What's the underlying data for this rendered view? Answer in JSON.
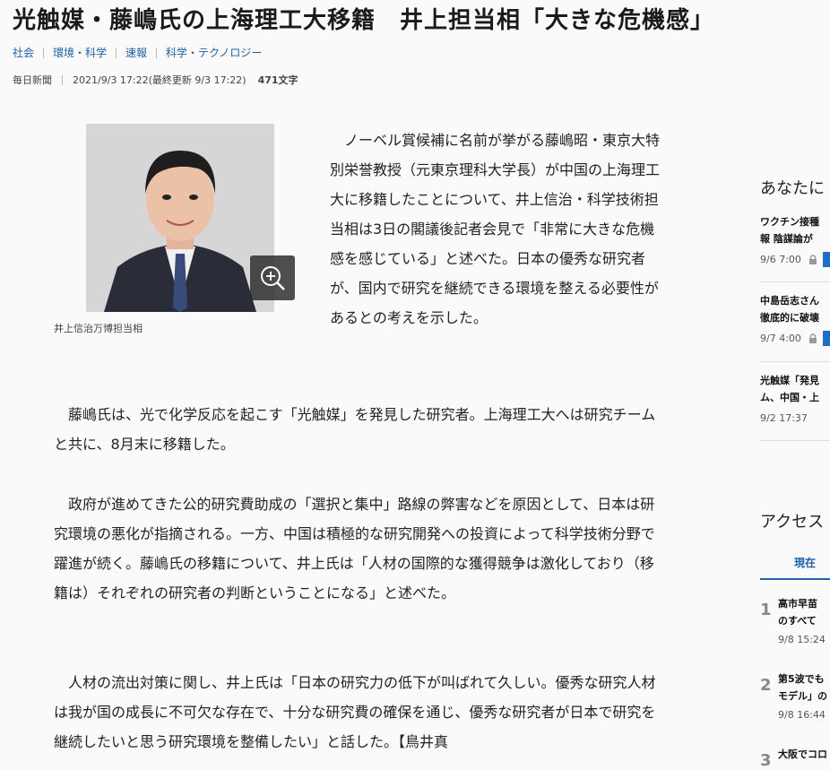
{
  "article": {
    "title": "光触媒・藤嶋氏の上海理工大移籍　井上担当相「大きな危機感」",
    "tags": [
      "社会",
      "環境・科学",
      "速報",
      "科学・テクノロジー"
    ],
    "source": "毎日新聞",
    "date": "2021/9/3 17:22(最終更新 9/3 17:22)",
    "char_count": "471文字",
    "photo_caption": "井上信治万博担当相",
    "paragraphs": [
      "　ノーベル賞候補に名前が挙がる藤嶋昭・東京大特別栄誉教授（元東京理科大学長）が中国の上海理工大に移籍したことについて、井上信治・科学技術担当相は3日の閣議後記者会見で「非常に大きな危機感を感じている」と述べた。日本の優秀な研究者が、国内で研究を継続できる環境を整える必要性があるとの考えを示した。",
      "　藤嶋氏は、光で化学反応を起こす「光触媒」を発見した研究者。上海理工大へは研究チームと共に、8月末に移籍した。",
      "　政府が進めてきた公的研究費助成の「選択と集中」路線の弊害などを原因として、日本は研究環境の悪化が指摘される。一方、中国は積極的な研究開発への投資によって科学技術分野で躍進が続く。藤嶋氏の移籍について、井上氏は「人材の国際的な獲得競争は激化しており（移籍は）それぞれの研究者の判断ということになる」と述べた。",
      "　人材の流出対策に関し、井上氏は「日本の研究力の低下が叫ばれて久しい。優秀な研究人材は我が国の成長に不可欠な存在で、十分な研究費の確保を通じ、優秀な研究者が日本で研究を継続したいと思う研究環境を整備したい」と話した。【鳥井真"
    ]
  },
  "sidebar": {
    "recommend_title": "あなたに",
    "recommend": [
      {
        "title": "ワクチン接種\n報 陰謀論が",
        "time": "9/6 7:00"
      },
      {
        "title": "中島岳志さん\n徹底的に破壊",
        "time": "9/7 4:00"
      },
      {
        "title": "光触媒「発見\nム、中国・上",
        "time": "9/2 17:37"
      }
    ],
    "ranking_title": "アクセス",
    "ranking_tab": "現在",
    "ranking": [
      {
        "rank": "1",
        "title": "高市早苗\nのすべて",
        "time": "9/8 15:24"
      },
      {
        "rank": "2",
        "title": "第5波でも\nモデル」の",
        "time": "9/8 16:44"
      },
      {
        "rank": "3",
        "title": "大阪でコロ",
        "time": ""
      }
    ]
  },
  "colors": {
    "link": "#1d5fa8",
    "badge": "#1d6fc4"
  }
}
